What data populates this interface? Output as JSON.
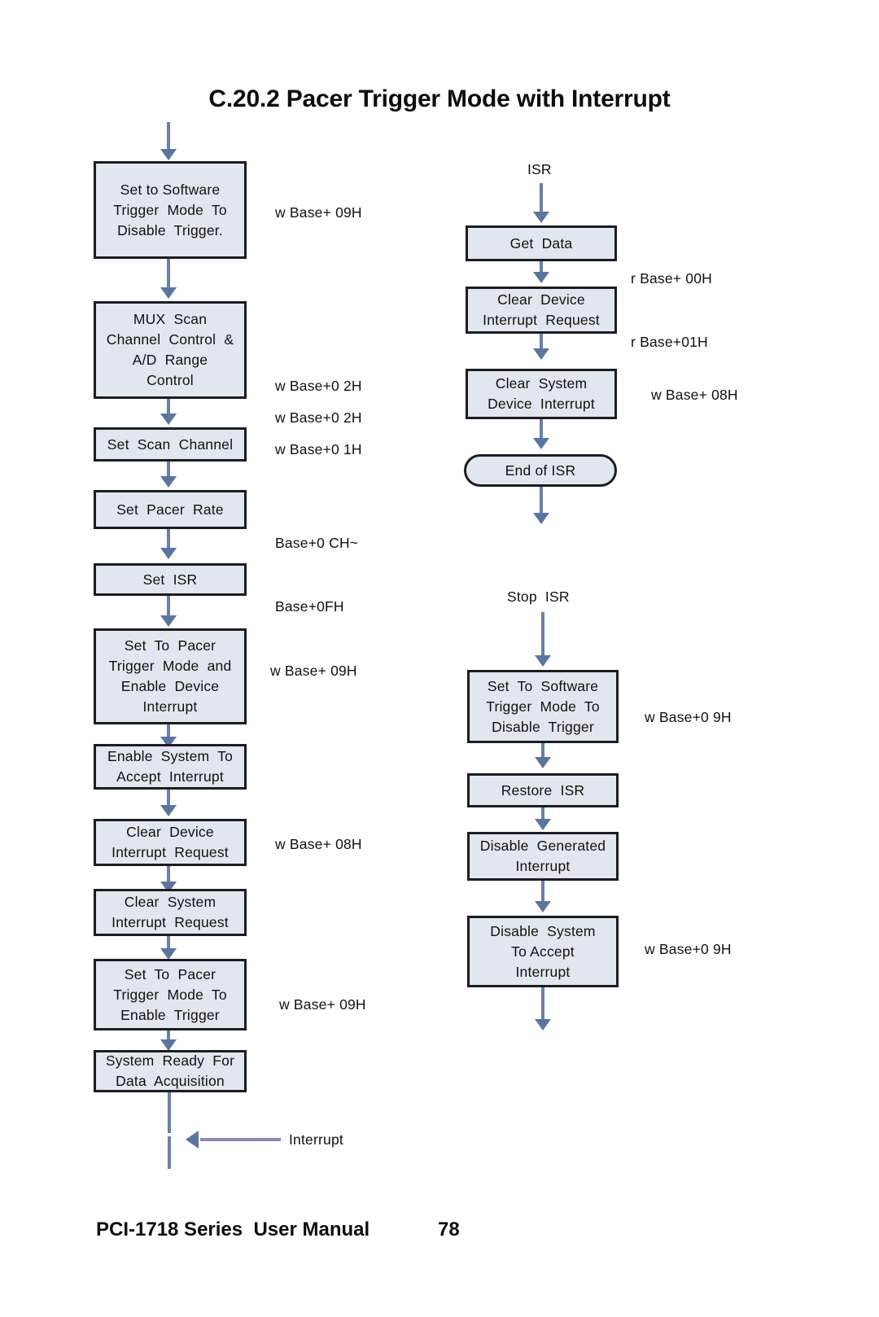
{
  "document": {
    "title": "C.20.2 Pacer Trigger Mode with Interrupt",
    "footer_title": "PCI-1718 Series  User Manual",
    "footer_page": "78"
  },
  "colors": {
    "box_fill": "#e2e6ef",
    "box_border": "#1c1c22",
    "arrow": "#5b759e",
    "interrupt_line": "#8c8ab0",
    "text": "#111111"
  },
  "labels": {
    "isr": "ISR",
    "stop_isr": "Stop  ISR",
    "interrupt": "Interrupt"
  },
  "main_flow": {
    "boxes": [
      {
        "id": "set-software-trigger-disable",
        "lines": [
          "Set to Software",
          "Trigger  Mode  To",
          "Disable  Trigger."
        ]
      },
      {
        "id": "mux-scan-channel-control",
        "lines": [
          "MUX  Scan",
          "Channel  Control  &",
          "A/D  Range",
          "Control"
        ]
      },
      {
        "id": "set-scan-channel",
        "lines": [
          "Set  Scan  Channel"
        ]
      },
      {
        "id": "set-pacer-rate",
        "lines": [
          "Set  Pacer  Rate"
        ]
      },
      {
        "id": "set-isr",
        "lines": [
          "Set  ISR"
        ]
      },
      {
        "id": "set-pacer-enable-device-int",
        "lines": [
          "Set  To  Pacer",
          "Trigger  Mode  and",
          "Enable  Device",
          "Interrupt"
        ]
      },
      {
        "id": "enable-system-accept-int",
        "lines": [
          "Enable  System  To",
          "Accept  Interrupt"
        ]
      },
      {
        "id": "clear-device-int-request",
        "lines": [
          "Clear  Device",
          "Interrupt  Request"
        ]
      },
      {
        "id": "clear-system-int-request",
        "lines": [
          "Clear  System",
          "Interrupt  Request"
        ]
      },
      {
        "id": "set-pacer-enable-trigger",
        "lines": [
          "Set  To  Pacer",
          "Trigger  Mode  To",
          "Enable  Trigger"
        ]
      },
      {
        "id": "system-ready-data-acq",
        "lines": [
          "System  Ready  For",
          "Data  Acquisition"
        ]
      }
    ],
    "annotations": [
      {
        "id": "anno-09h-1",
        "lines": [
          "w Base+ 09H"
        ]
      },
      {
        "id": "anno-02h-01h",
        "lines": [
          "w Base+0 2H",
          "w Base+0 1H"
        ]
      },
      {
        "id": "anno-02h",
        "lines": [
          "w Base+0 2H"
        ]
      },
      {
        "id": "anno-ch-fh",
        "lines": [
          "Base+0 CH~",
          "Base+0FH"
        ]
      },
      {
        "id": "anno-09h-2",
        "lines": [
          "w Base+ 09H"
        ]
      },
      {
        "id": "anno-08h-1",
        "lines": [
          "w Base+ 08H"
        ]
      },
      {
        "id": "anno-09h-3",
        "lines": [
          "w Base+ 09H"
        ]
      }
    ]
  },
  "isr_flow": {
    "boxes": [
      {
        "id": "get-data",
        "lines": [
          "Get  Data"
        ]
      },
      {
        "id": "clear-device-int-request-isr",
        "lines": [
          "Clear  Device",
          "Interrupt  Request"
        ]
      },
      {
        "id": "clear-system-device-int",
        "lines": [
          "Clear  System",
          "Device  Interrupt"
        ]
      }
    ],
    "terminator": {
      "id": "end-of-isr",
      "text": "End  of  ISR"
    },
    "annotations": [
      {
        "id": "anno-r-00h-01h",
        "lines": [
          "r Base+ 00H",
          "r Base+01H"
        ]
      },
      {
        "id": "anno-w-08h",
        "lines": [
          "w Base+ 08H"
        ]
      }
    ]
  },
  "stop_flow": {
    "boxes": [
      {
        "id": "set-software-trigger-disable-stop",
        "lines": [
          "Set  To  Software",
          "Trigger  Mode  To",
          "Disable  Trigger"
        ]
      },
      {
        "id": "restore-isr",
        "lines": [
          "Restore  ISR"
        ]
      },
      {
        "id": "disable-generated-interrupt",
        "lines": [
          "Disable  Generated",
          "Interrupt"
        ]
      },
      {
        "id": "disable-system-accept-int",
        "lines": [
          "Disable  System",
          "To Accept",
          "Interrupt"
        ]
      }
    ],
    "annotations": [
      {
        "id": "anno-w-09h-stop1",
        "lines": [
          "w Base+0 9H"
        ]
      },
      {
        "id": "anno-w-09h-stop2",
        "lines": [
          "w Base+0 9H"
        ]
      }
    ]
  }
}
